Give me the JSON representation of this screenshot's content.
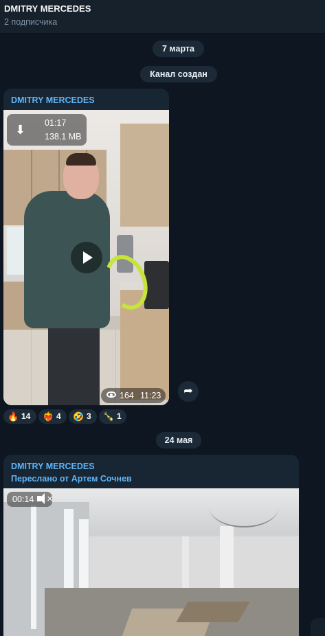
{
  "channel": {
    "title": "DMITRY MERCEDES",
    "subscribers": "2 подписчика"
  },
  "dates": {
    "first": "7 марта",
    "second": "24 мая"
  },
  "service": {
    "created": "Канал создан"
  },
  "post1": {
    "author": "DMITRY MERCEDES",
    "video": {
      "duration": "01:17",
      "size": "138.1 MB",
      "download_icon": "download-icon",
      "play_icon": "play-icon"
    },
    "views": "164",
    "time": "11:23",
    "share_icon": "share-icon",
    "reactions": [
      {
        "emoji": "🔥",
        "count": "14"
      },
      {
        "emoji": "❤️‍🔥",
        "count": "4"
      },
      {
        "emoji": "🤣",
        "count": "3"
      },
      {
        "emoji": "🍾",
        "count": "1"
      }
    ]
  },
  "post2": {
    "author": "DMITRY MERCEDES",
    "forwarded": "Переслано от Артем Сочнев",
    "video": {
      "duration": "00:14",
      "mute_icon": "mute-icon"
    }
  },
  "colors": {
    "background": "#0e1621",
    "bubble": "#182533",
    "accent": "#5eb5f7"
  }
}
